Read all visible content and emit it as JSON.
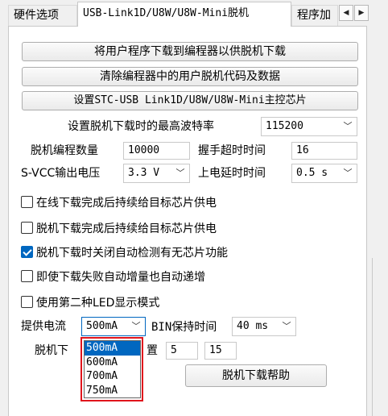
{
  "tabs": [
    {
      "label": "硬件选项"
    },
    {
      "label": "USB-Link1D/U8W/U8W-Mini脱机"
    },
    {
      "label": "程序加"
    }
  ],
  "tab_scroll": {
    "left": "◀",
    "right": "▶"
  },
  "buttons": {
    "download_user_program": "将用户程序下载到编程器以供脱机下载",
    "clear_user_code": "清除编程器中的用户脱机代码及数据",
    "set_master_chip": "设置STC-USB Link1D/U8W/U8W-Mini主控芯片",
    "offline_help": "脱机下载帮助"
  },
  "baud": {
    "label": "设置脱机下载时的最高波特率",
    "value": "115200"
  },
  "offline_count": {
    "label": "脱机编程数量",
    "value": "10000"
  },
  "handshake_timeout": {
    "label": "握手超时时间",
    "value": "16"
  },
  "svcc_voltage": {
    "label": "S-VCC输出电压",
    "value": "3.3 V"
  },
  "power_on_delay": {
    "label": "上电延时时间",
    "value": "0.5 s"
  },
  "checkboxes": [
    {
      "label": "在线下载完成后持续给目标芯片供电",
      "checked": false
    },
    {
      "label": "脱机下载完成后持续给目标芯片供电",
      "checked": false
    },
    {
      "label": "脱机下载时关闭自动检测有无芯片功能",
      "checked": true
    },
    {
      "label": "即使下载失败自动增量也自动递增",
      "checked": false
    },
    {
      "label": "使用第二种LED显示模式",
      "checked": false
    }
  ],
  "supply_current": {
    "label": "提供电流",
    "value": "500mA",
    "options": [
      "500mA",
      "600mA",
      "700mA",
      "750mA"
    ],
    "selected_index": 0
  },
  "bin_hold_time": {
    "label": "BIN保持时间",
    "value": "40 ms"
  },
  "offline_setting": {
    "label_left": "脱机下",
    "label_right": "置",
    "value_a": "5",
    "value_b": "15"
  },
  "icons": {
    "chevron": "chevron-down-icon",
    "check": "check-icon"
  },
  "colors": {
    "accent": "#0067c0",
    "highlight_border": "#e0141c"
  }
}
